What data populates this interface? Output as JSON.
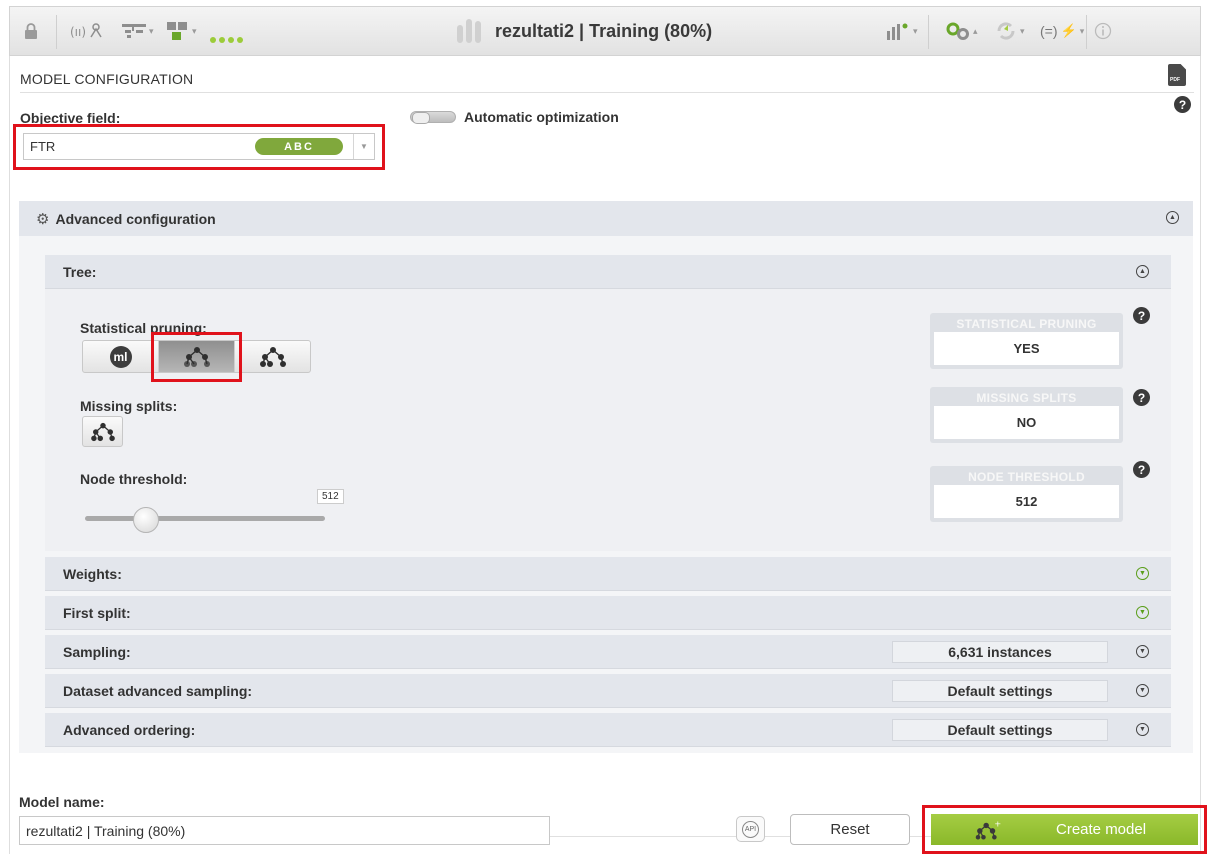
{
  "toolbar": {
    "title": "rezultati2 | Training (80%)",
    "icons": [
      "lock-icon",
      "dataset-fields-icon",
      "tree-structure-icon",
      "summary-icon",
      "progress-dots-icon",
      "chart-icon",
      "configure-gears-icon",
      "refresh-icon",
      "formula-icon",
      "info-icon"
    ]
  },
  "section_title": "MODEL CONFIGURATION",
  "objective": {
    "label": "Objective field:",
    "value": "FTR",
    "type_badge": "ABC",
    "auto_label": "Automatic optimization",
    "auto_enabled": false
  },
  "advanced": {
    "title": "Advanced configuration",
    "tree": {
      "title": "Tree:",
      "stat_pruning_label": "Statistical pruning:",
      "stat_pruning_selected": "second",
      "missing_splits_label": "Missing splits:",
      "node_threshold_label": "Node threshold:",
      "node_threshold_value": "512",
      "info": [
        {
          "caption": "STATISTICAL PRUNING",
          "value": "YES"
        },
        {
          "caption": "MISSING SPLITS",
          "value": "NO"
        },
        {
          "caption": "NODE THRESHOLD",
          "value": "512"
        }
      ]
    },
    "sections": [
      {
        "title": "Weights:",
        "value": ""
      },
      {
        "title": "First split:",
        "value": ""
      },
      {
        "title": "Sampling:",
        "value": "6,631 instances"
      },
      {
        "title": "Dataset advanced sampling:",
        "value": "Default settings"
      },
      {
        "title": "Advanced ordering:",
        "value": "Default settings"
      }
    ]
  },
  "model_name": {
    "label": "Model name:",
    "value": "rezultati2 | Training (80%)"
  },
  "buttons": {
    "api": "API",
    "reset": "Reset",
    "create": "Create model"
  },
  "colors": {
    "accent_green": "#8ab82a",
    "highlight_red": "#e0121b",
    "badge_green": "#80a83c"
  }
}
